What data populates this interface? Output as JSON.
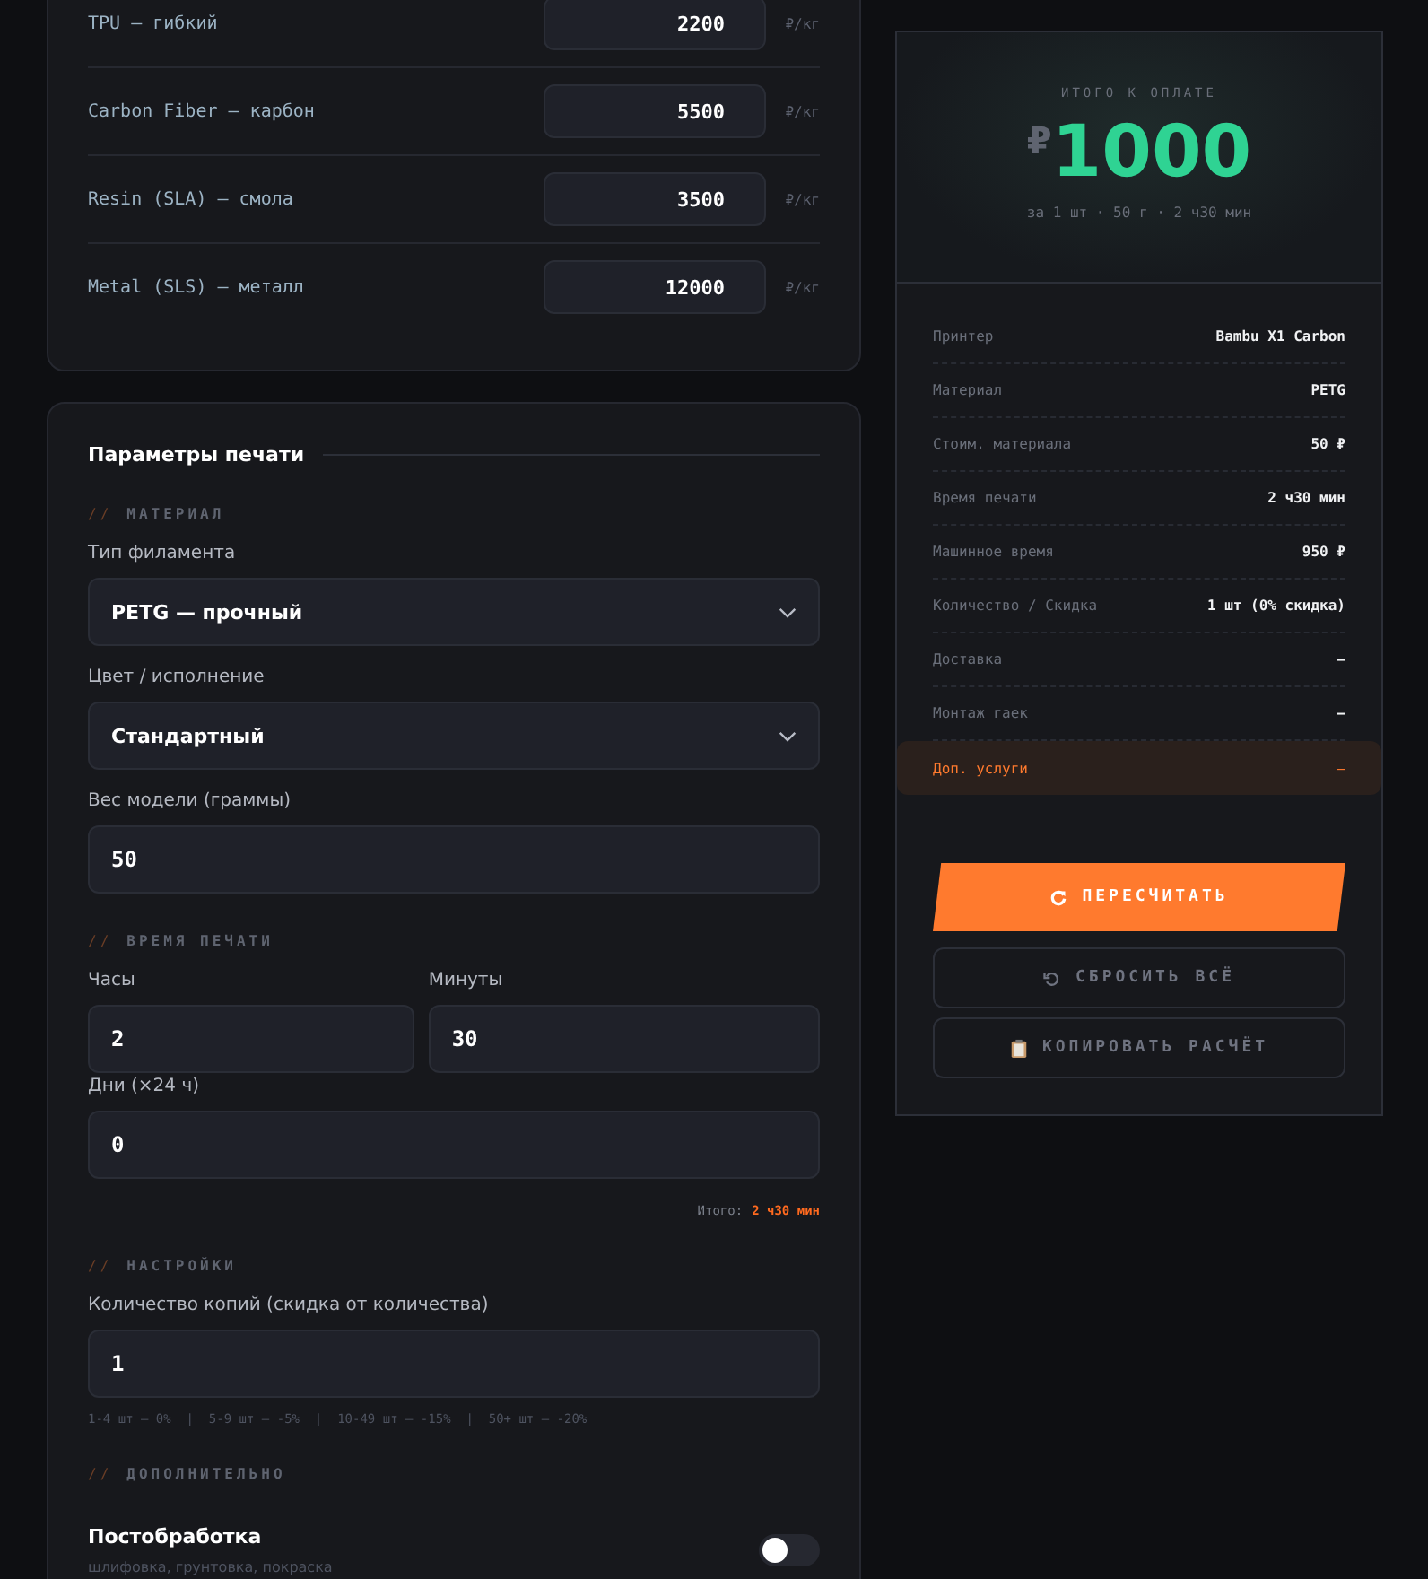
{
  "prices": {
    "rows": [
      {
        "label": "TPU — гибкий",
        "value": "2200",
        "unit": "₽/кг"
      },
      {
        "label": "Carbon Fiber — карбон",
        "value": "5500",
        "unit": "₽/кг"
      },
      {
        "label": "Resin (SLA) — смола",
        "value": "3500",
        "unit": "₽/кг"
      },
      {
        "label": "Metal (SLS) — металл",
        "value": "12000",
        "unit": "₽/кг"
      }
    ]
  },
  "params": {
    "title": "Параметры печати",
    "material_heading": {
      "prefix": "//",
      "text": "МАТЕРИАЛ"
    },
    "filament": {
      "label": "Тип филамента",
      "value": "PETG — прочный"
    },
    "color": {
      "label": "Цвет / исполнение",
      "value": "Стандартный"
    },
    "weight": {
      "label": "Вес модели (граммы)",
      "value": "50"
    },
    "time_heading": {
      "prefix": "//",
      "text": "ВРЕМЯ ПЕЧАТИ"
    },
    "hours": {
      "label": "Часы",
      "value": "2"
    },
    "minutes": {
      "label": "Минуты",
      "value": "30"
    },
    "days": {
      "label": "Дни (×24 ч)",
      "value": "0"
    },
    "total": {
      "label": "Итого:",
      "value": "2 ч30 мин"
    },
    "settings_heading": {
      "prefix": "//",
      "text": "НАСТРОЙКИ"
    },
    "copies": {
      "label": "Количество копий (скидка от количества)",
      "value": "1",
      "hint": "1-4 шт — 0%  |  5-9 шт — -5%  |  10-49 шт — -15%  |  50+ шт — -20%"
    },
    "extra_heading": {
      "prefix": "//",
      "text": "ДОПОЛНИТЕЛЬНО"
    },
    "postprocessing": {
      "title": "Постобработка",
      "subtitle": "шлифовка, грунтовка, покраска",
      "on": false
    }
  },
  "summary": {
    "label": "ИТОГО К ОПЛАТЕ",
    "currency": "₽",
    "amount": "1000",
    "subtitle": "за 1 шт · 50 г · 2 ч30 мин",
    "rows": [
      {
        "label": "Принтер",
        "value": "Bambu X1 Carbon",
        "highlighted": false
      },
      {
        "label": "Материал",
        "value": "PETG",
        "highlighted": false
      },
      {
        "label": "Стоим. материала",
        "value": "50 ₽",
        "highlighted": false
      },
      {
        "label": "Время печати",
        "value": "2 ч30 мин",
        "highlighted": false
      },
      {
        "label": "Машинное время",
        "value": "950 ₽",
        "highlighted": false
      },
      {
        "label": "Количество / Скидка",
        "value": "1 шт (0% скидка)",
        "highlighted": false
      },
      {
        "label": "Доставка",
        "value": "—",
        "highlighted": false
      },
      {
        "label": "Монтаж гаек",
        "value": "—",
        "highlighted": false
      },
      {
        "label": "Доп. услуги",
        "value": "—",
        "highlighted": true
      }
    ],
    "buttons": [
      {
        "label": "ПЕРЕСЧИТАТЬ",
        "kind": "primary"
      },
      {
        "label": "СБРОСИТЬ ВСЁ",
        "kind": "secondary"
      },
      {
        "label": "КОПИРОВАТЬ РАСЧЁТ",
        "kind": "secondary"
      }
    ]
  }
}
